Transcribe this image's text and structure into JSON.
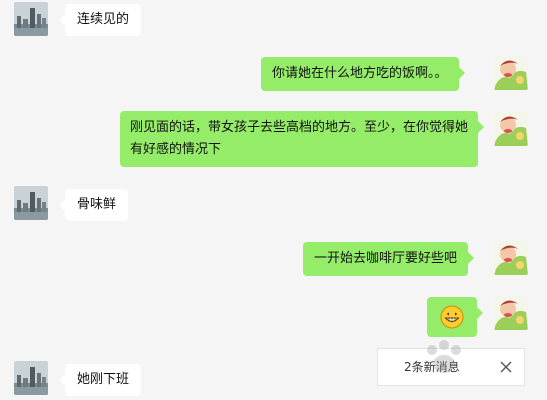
{
  "messages": [
    {
      "side": "left",
      "text": "连续见的"
    },
    {
      "side": "right",
      "text": "你请她在什么地方吃的饭啊。。"
    },
    {
      "side": "right",
      "text": "刚见面的话，带女孩子去些高档的地方。至少，在你觉得她有好感的情况下"
    },
    {
      "side": "left",
      "text": "骨味鲜"
    },
    {
      "side": "right",
      "text": "一开始去咖啡厅要好些吧"
    },
    {
      "side": "right",
      "emoji": "grinning-face"
    },
    {
      "side": "left",
      "text": "她刚下班"
    }
  ],
  "new_messages": {
    "label": "2条新消息"
  },
  "colors": {
    "background": "#f5f5f5",
    "incoming_bubble": "#ffffff",
    "outgoing_bubble": "#95ec69"
  },
  "icons": {
    "contact_avatar": "city-skyline-avatar",
    "self_avatar": "cartoon-avatar",
    "close": "close-icon"
  }
}
